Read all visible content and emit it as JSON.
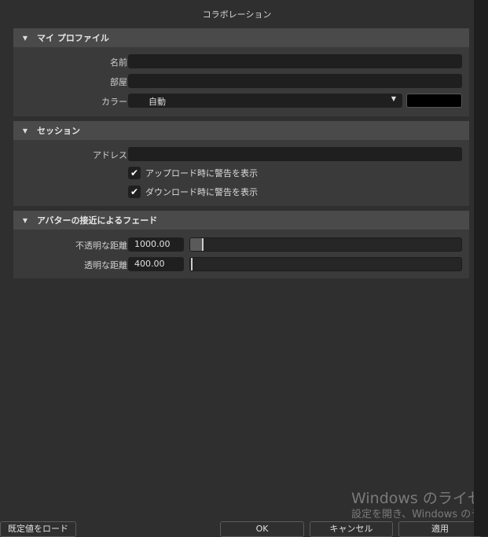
{
  "title": "コラボレーション",
  "profile": {
    "header": "マイ プロファイル",
    "name_label": "名前",
    "name_value": "",
    "room_label": "部屋",
    "room_value": "",
    "color_label": "カラー",
    "color_value": "自動",
    "swatch": "#000000"
  },
  "session": {
    "header": "セッション",
    "address_label": "アドレス",
    "address_value": "",
    "upload_warn": "アップロード時に警告を表示",
    "upload_checked": true,
    "download_warn": "ダウンロード時に警告を表示",
    "download_checked": true
  },
  "fade": {
    "header": "アバターの接近によるフェード",
    "opaque_label": "不透明な距離",
    "opaque_value": "1000.00",
    "opaque_fraction": 0.05,
    "transparent_label": "透明な距離",
    "transparent_value": "400.00",
    "transparent_fraction": 0.01
  },
  "watermark": {
    "line1": "Windows のライセンス",
    "line2": "設定を開き、Windows のライ"
  },
  "buttons": {
    "load_defaults": "既定値をロード",
    "ok": "OK",
    "cancel": "キャンセル",
    "apply": "適用"
  }
}
